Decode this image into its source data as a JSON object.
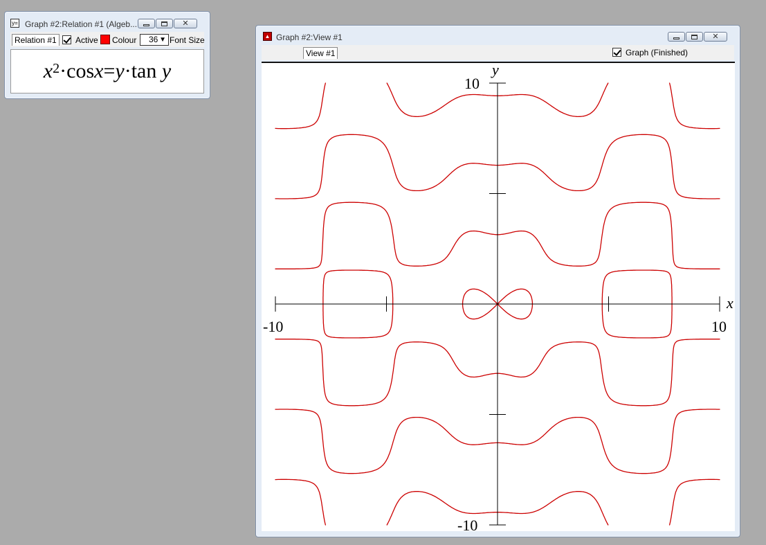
{
  "relation_window": {
    "title": "Graph #2:Relation #1 (Algeb...",
    "icon_text": "y=",
    "tab_label": "Relation #1",
    "active_label": "Active",
    "active_checked": true,
    "colour_label": "Colour",
    "colour_value": "#ff0000",
    "font_size_value": "36",
    "font_size_label": "Font Size",
    "formula": {
      "base": "x",
      "exponent": "2",
      "dot1": "·",
      "cos": "cos",
      "x2": "x",
      "eq": "=",
      "y1": "y",
      "dot2": "·",
      "tan": "tan",
      "y2": "y"
    }
  },
  "view_window": {
    "title": "Graph #2:View #1",
    "tab_label": "View #1",
    "graph_label": "Graph (Finished)",
    "graph_checked": true
  },
  "chart_data": {
    "type": "line",
    "title": "",
    "relation": "x^2*cos(x) = y*tan(y)",
    "xlabel": "x",
    "ylabel": "y",
    "xlim": [
      -10,
      10
    ],
    "ylim": [
      -10,
      10
    ],
    "x_tick_labels": [
      "-10",
      "10"
    ],
    "y_tick_labels": [
      "10",
      "-10"
    ],
    "x_ticks": [
      -10,
      -5,
      5,
      10
    ],
    "y_ticks": [
      10,
      5,
      -5,
      -10
    ],
    "curve_color": "#cc0000",
    "grid": false
  }
}
